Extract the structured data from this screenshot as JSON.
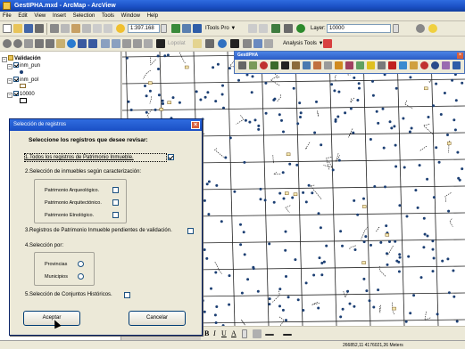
{
  "window": {
    "title": "GestIPHA.mxd - ArcMap - ArcView"
  },
  "menu": [
    "File",
    "Edit",
    "View",
    "Insert",
    "Selection",
    "Tools",
    "Window",
    "Help"
  ],
  "toolbar": {
    "scale": "1:397.168",
    "itools_label": "ITools Pro ▼",
    "layer_label": "Layer:",
    "layer_value": "10000",
    "analysis_label": "Analysis Tools ▼"
  },
  "toc": {
    "root": "Validación",
    "layers": [
      {
        "label": "inm_pun",
        "checked": true
      },
      {
        "label": "inm_pol",
        "checked": true
      },
      {
        "label": "10000",
        "checked": true
      }
    ]
  },
  "floating_toolbar": {
    "title": "GestIPHA"
  },
  "dialog": {
    "title": "Selección de registros",
    "heading": "Seleccione los registros que desee revisar:",
    "option1": "1.Todos los registros de Patrimonio Inmueble.",
    "option1_checked": true,
    "option2": "2.Selección de inmuebles según caracterización:",
    "types": [
      {
        "label": "Patrimonio Arqueológico."
      },
      {
        "label": "Patrimonio Arquitectónico."
      },
      {
        "label": "Patrimonio Etnológico."
      }
    ],
    "option3": "3.Registros de Patrimonio Inmueble pendientes de validación.",
    "option4": "4.Selección por:",
    "scopes": [
      {
        "label": "Provincias"
      },
      {
        "label": "Municipios"
      }
    ],
    "option5": "5.Selección de Conjuntos Históricos.",
    "accept_label": "Aceptar",
    "cancel_label": "Cancelar"
  },
  "status": {
    "coordinates": "266852,11  4176021,26 Meters"
  },
  "colors": {
    "title_blue": "#1a4fc4",
    "point_blue": "#1c3f73",
    "parcel_line": "#111111"
  }
}
